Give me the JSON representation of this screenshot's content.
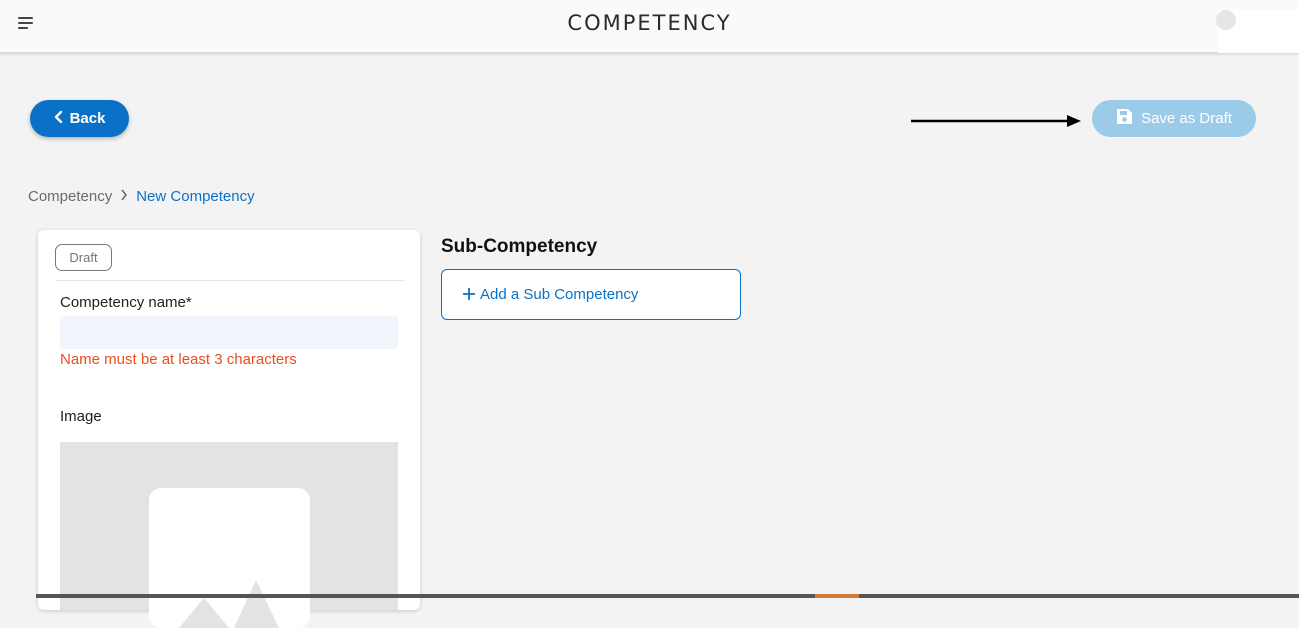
{
  "header": {
    "title": "COMPETENCY",
    "menu_icon": "hamburger-menu-icon"
  },
  "toolbar": {
    "back_label": "Back",
    "back_icon": "chevron-left-icon",
    "save_draft_label": "Save as Draft",
    "save_draft_icon": "floppy-disk-icon",
    "save_draft_enabled": false
  },
  "breadcrumb": {
    "root": "Competency",
    "separator_icon": "chevron-right-icon",
    "current": "New Competency"
  },
  "form": {
    "status_chip": "Draft",
    "name_label": "Competency name*",
    "name_value": "",
    "name_error": "Name must be at least 3 characters",
    "image_label": "Image",
    "image_icon": "image-placeholder-icon"
  },
  "sub_competency": {
    "title": "Sub-Competency",
    "add_label": "Add a Sub Competency",
    "add_icon": "plus-icon"
  },
  "colors": {
    "accent": "#0a72c6",
    "disabled_button": "#9ccae9",
    "error": "#e8501e",
    "background": "#f3f3f4"
  }
}
